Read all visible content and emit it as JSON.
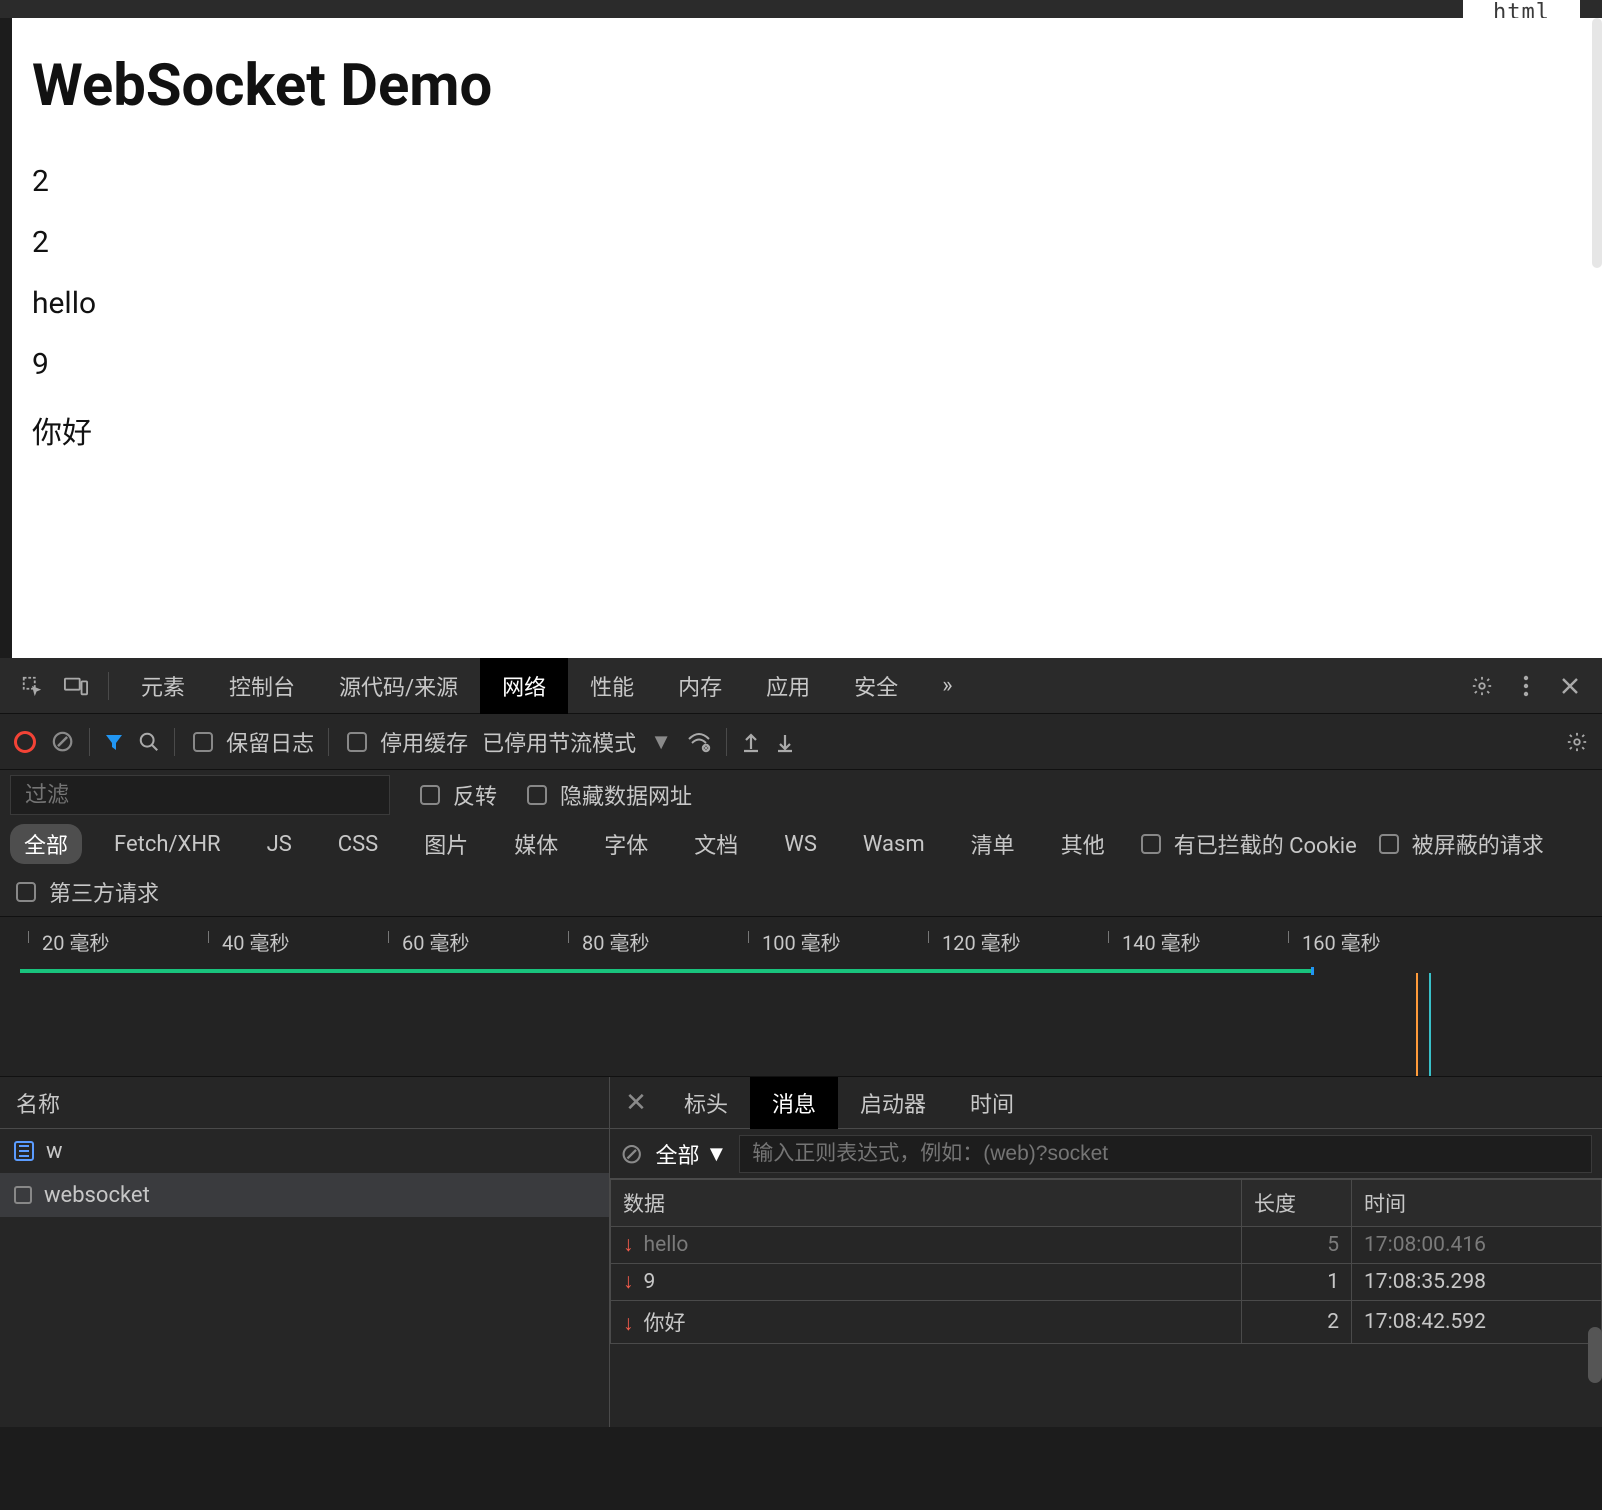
{
  "overlay_label": "html",
  "page": {
    "title": "WebSocket Demo",
    "messages": [
      "2",
      "2",
      "hello",
      "9",
      "你好"
    ]
  },
  "devtools": {
    "tabs": [
      "元素",
      "控制台",
      "源代码/来源",
      "网络",
      "性能",
      "内存",
      "应用",
      "安全"
    ],
    "more": "»",
    "active_tab": 3,
    "toolbar": {
      "preserve_log": "保留日志",
      "disable_cache": "停用缓存",
      "throttling": "已停用节流模式"
    },
    "filter": {
      "placeholder": "过滤",
      "invert": "反转",
      "hide_data_urls": "隐藏数据网址",
      "chips": [
        "全部",
        "Fetch/XHR",
        "JS",
        "CSS",
        "图片",
        "媒体",
        "字体",
        "文档",
        "WS",
        "Wasm",
        "清单",
        "其他"
      ],
      "active_chip": 0,
      "blocked_cookies": "有已拦截的 Cookie",
      "blocked_requests": "被屏蔽的请求",
      "third_party": "第三方请求"
    },
    "timeline": {
      "ticks": [
        "20 毫秒",
        "40 毫秒",
        "60 毫秒",
        "80 毫秒",
        "100 毫秒",
        "120 毫秒",
        "140 毫秒",
        "160 毫秒"
      ]
    },
    "names": {
      "header": "名称",
      "rows": [
        {
          "label": "w",
          "icon": "doc",
          "selected": false
        },
        {
          "label": "websocket",
          "icon": "square",
          "selected": true
        }
      ]
    },
    "messages_panel": {
      "tabs": [
        "标头",
        "消息",
        "启动器",
        "时间"
      ],
      "active_tab": 1,
      "all_label": "全部",
      "regex_placeholder": "输入正则表达式，例如：(web)?socket",
      "columns": {
        "data": "数据",
        "length": "长度",
        "time": "时间"
      },
      "rows": [
        {
          "data": "hello",
          "length": "5",
          "time": "17:08:00.416",
          "dir": "down",
          "faded": true
        },
        {
          "data": "9",
          "length": "1",
          "time": "17:08:35.298",
          "dir": "down",
          "faded": false
        },
        {
          "data": "你好",
          "length": "2",
          "time": "17:08:42.592",
          "dir": "down",
          "faded": false
        }
      ]
    }
  }
}
